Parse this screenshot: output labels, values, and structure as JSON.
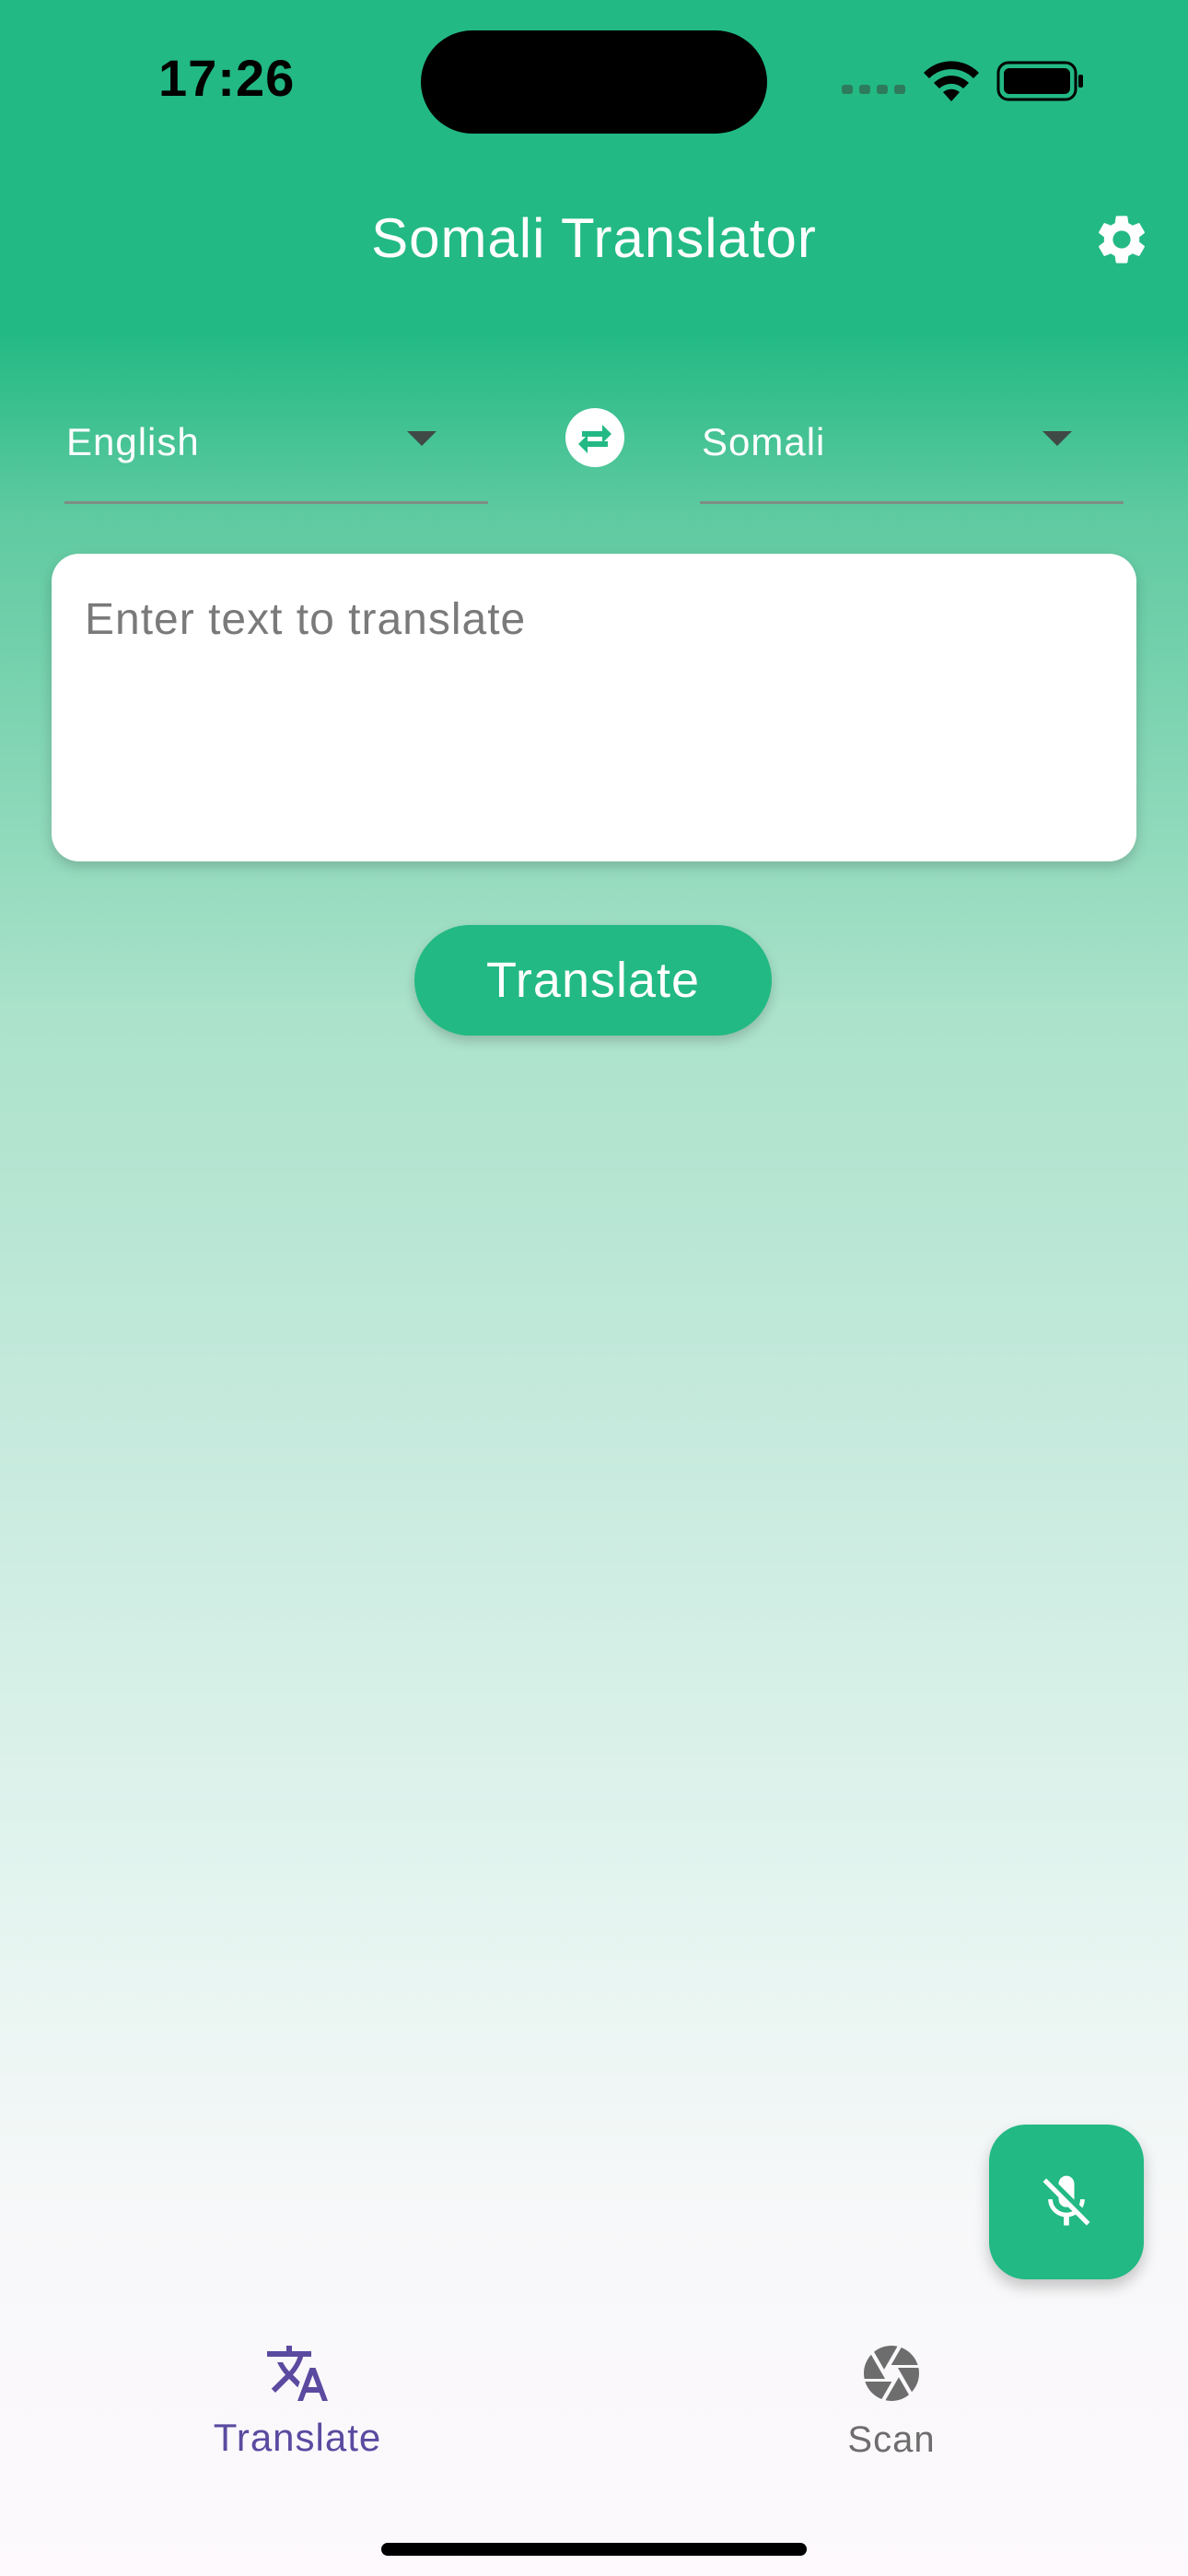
{
  "status_bar": {
    "time": "17:26"
  },
  "app_bar": {
    "title": "Somali Translator",
    "settings_icon": "gear-icon"
  },
  "languages": {
    "from": "English",
    "to": "Somali",
    "swap_icon": "swap-arrows-icon"
  },
  "input": {
    "value": "",
    "placeholder": "Enter text to translate"
  },
  "translate_button": {
    "label": "Translate"
  },
  "fab": {
    "icon": "mic-off-icon"
  },
  "bottom_nav": {
    "items": [
      {
        "label": "Translate",
        "icon": "translate-icon",
        "active": true
      },
      {
        "label": "Scan",
        "icon": "camera-shutter-icon",
        "active": false
      }
    ]
  },
  "colors": {
    "primary": "#22b984",
    "active_nav": "#5b4aa0",
    "inactive_nav": "#6d6d6d"
  }
}
